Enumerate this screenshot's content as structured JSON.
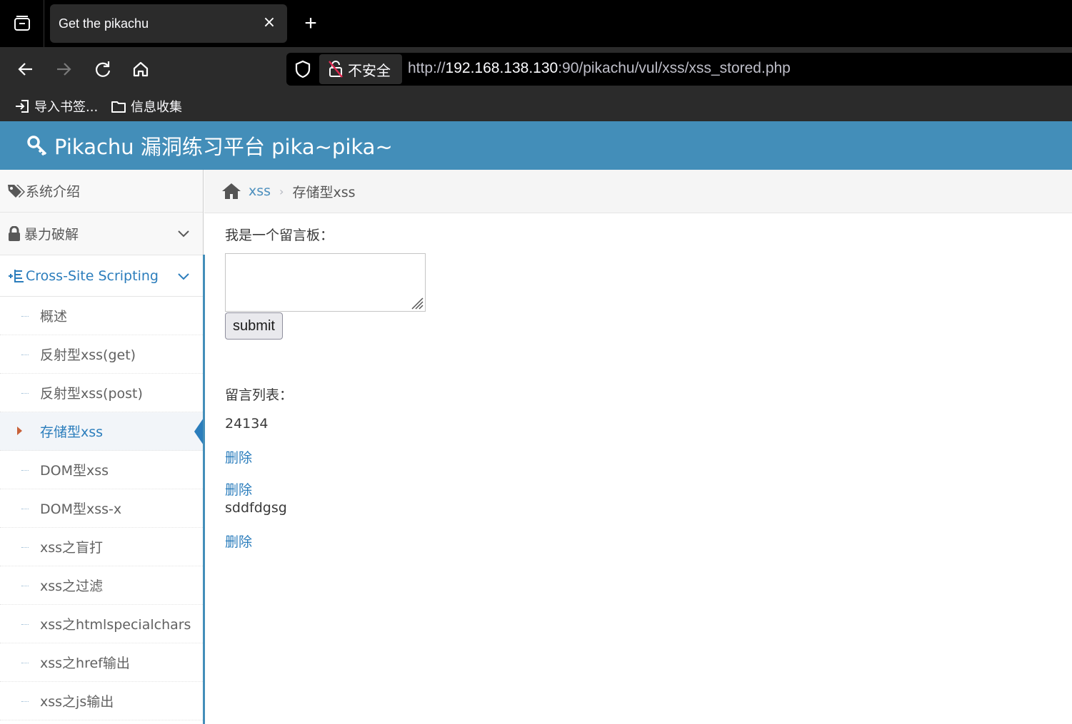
{
  "browser": {
    "tab_title": "Get the pikachu",
    "tab_close": "×",
    "new_tab": "+",
    "insecure_label": "不安全",
    "url_scheme": "http://",
    "url_host": "192.168.138.130",
    "url_rest": ":90/pikachu/vul/xss/xss_stored.php",
    "bookmarks": [
      {
        "label": "导入书签...",
        "icon": "import-icon"
      },
      {
        "label": "信息收集",
        "icon": "folder-icon"
      }
    ]
  },
  "app": {
    "title": "Pikachu 漏洞练习平台 pika~pika~",
    "accent": "#438eb9"
  },
  "sidebar": {
    "items": [
      {
        "label": "系统介绍",
        "icon": "tag-icon"
      },
      {
        "label": "暴力破解",
        "icon": "lock-icon"
      },
      {
        "label": "Cross-Site Scripting",
        "icon": "list-icon"
      }
    ],
    "submenu": [
      "概述",
      "反射型xss(get)",
      "反射型xss(post)",
      "存储型xss",
      "DOM型xss",
      "DOM型xss-x",
      "xss之盲打",
      "xss之过滤",
      "xss之htmlspecialchars",
      "xss之href输出",
      "xss之js输出"
    ],
    "active_index": 3
  },
  "breadcrumb": {
    "link": "xss",
    "current": "存储型xss"
  },
  "main": {
    "board_label": "我是一个留言板：",
    "submit_label": "submit",
    "list_label": "留言列表：",
    "messages": [
      {
        "text": "24134",
        "delete": "删除"
      },
      {
        "text": "",
        "delete": "删除"
      },
      {
        "text": "sddfdgsg",
        "delete": "删除"
      }
    ]
  }
}
